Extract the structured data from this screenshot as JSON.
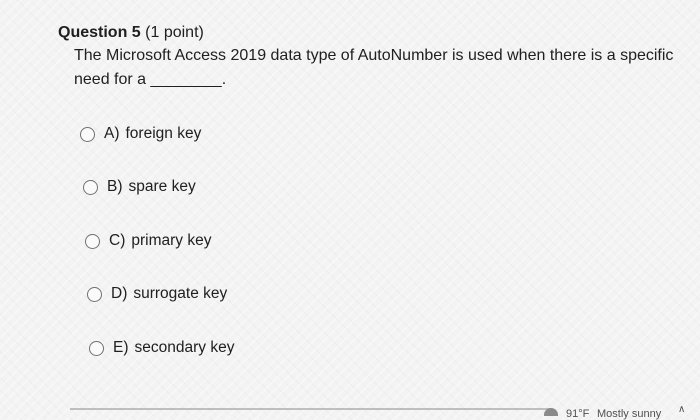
{
  "question": {
    "title": "Question 5",
    "points": "(1 point)",
    "text_line1": "The Microsoft Access 2019 data type of AutoNumber is used when there is a specific",
    "text_line2": "need for a ________."
  },
  "options": [
    {
      "letter": "A)",
      "label": "foreign key",
      "selected": false
    },
    {
      "letter": "B)",
      "label": "spare key",
      "selected": false
    },
    {
      "letter": "C)",
      "label": "primary key",
      "selected": false
    },
    {
      "letter": "D)",
      "label": "surrogate key",
      "selected": false
    },
    {
      "letter": "E)",
      "label": "secondary key",
      "selected": false
    }
  ],
  "taskbar": {
    "temperature": "91°F",
    "weather": "Mostly sunny",
    "weather_icon": "sun-cloud-icon",
    "tray_icon": "chevron-up-icon"
  }
}
